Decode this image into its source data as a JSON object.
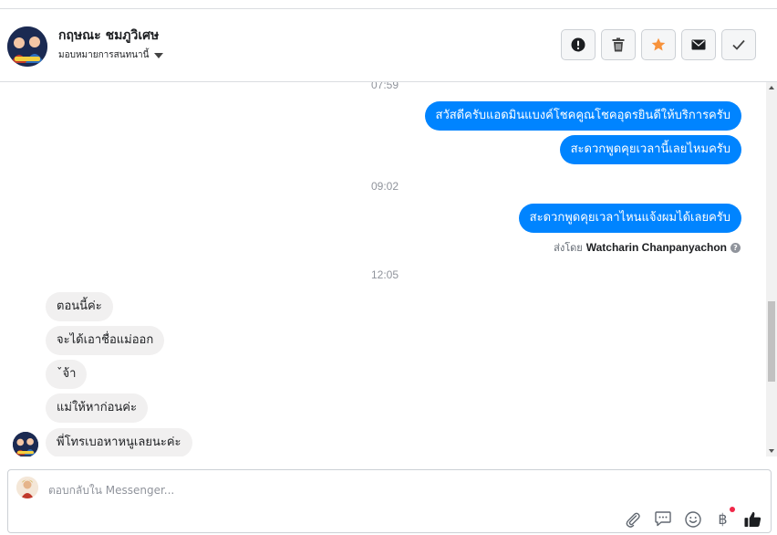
{
  "header": {
    "contact_name": "กฤษณะ ชมภูวิเศษ",
    "assign_label": "มอบหมายการสนทนานี้",
    "actions": [
      {
        "name": "mark-spam-button",
        "icon": "exclamation-icon"
      },
      {
        "name": "delete-button",
        "icon": "trash-icon"
      },
      {
        "name": "star-button",
        "icon": "star-icon"
      },
      {
        "name": "mark-unread-button",
        "icon": "envelope-icon"
      },
      {
        "name": "mark-done-button",
        "icon": "check-icon"
      }
    ]
  },
  "chat": {
    "times": [
      "07:59",
      "09:02",
      "12:05"
    ],
    "outgoing": [
      "สวัสดีครับแอดมินแบงค์โชคคูณโชคอุดรยินดีให้บริการครับ",
      "สะดวกพูดคุยเวลานี้เลยไหมครับ",
      "สะดวกพูดคุยเวลาไหนแจ้งผมได้เลยครับ"
    ],
    "sent_by_prefix": "ส่งโดย",
    "sent_by_name": "Watcharin Chanpanyachon",
    "incoming": [
      "ตอนนี้ค่ะ",
      "จะได้เอาชื่อแม่ออก",
      "ˇจ้า",
      "แม่ให้หาก่อนค่ะ",
      "พี่โทรเบอหาหนูเลยนะค่ะ"
    ]
  },
  "composer": {
    "placeholder": "ตอบกลับใน Messenger...",
    "tools": [
      "paperclip-icon",
      "speech-bubble-icon",
      "smiley-icon",
      "baht-icon",
      "thumbs-up-icon"
    ]
  },
  "colors": {
    "outgoing_bubble": "#0084ff",
    "incoming_bubble": "#f1f0f0",
    "star": "#f7923b",
    "notification_dot": "#f02849"
  }
}
